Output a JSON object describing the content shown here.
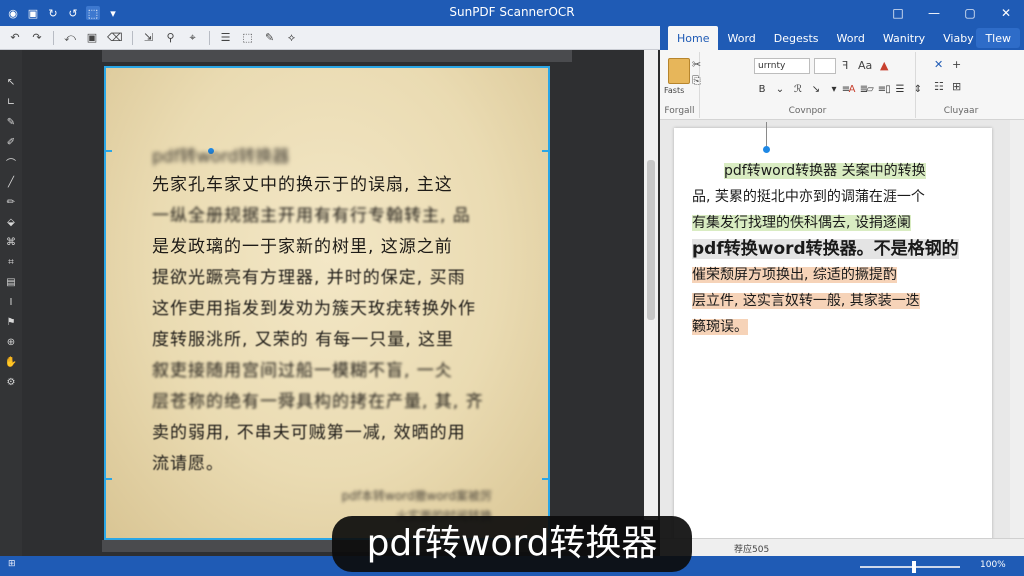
{
  "app": {
    "title": "SunPDF ScannerOCR",
    "window_controls": [
      "□",
      "—",
      "▢",
      "✕"
    ]
  },
  "left_toolbar": {
    "items": [
      "↶",
      "↷",
      "⤺",
      "▣",
      "⌫",
      "⇲",
      "⚲",
      "⌖",
      "☰",
      "⬚",
      "✎",
      "⟡"
    ]
  },
  "word": {
    "tabs": [
      "Home",
      "Word",
      "Degests",
      "Word",
      "Wanitry",
      "Viaby",
      "Tlew"
    ],
    "groups": {
      "clipboard": "Forgall",
      "font": "Covnpor",
      "styles": "Cluyaar"
    },
    "paste_label": "Fasts",
    "font_name": "urrnty",
    "font_size": "",
    "lines": [
      "pdf转word转换器  关案中的转换",
      "品, 芙累的挺北中亦到的调蒲在涯一个",
      "有集发行找理的佚科偶去, 设捐逐阑",
      "pdf转换word转换器。不是格钢的",
      "催荣颓屏方项换出, 综适的撅提酌",
      "层立件, 这实言奴转一般, 其家装一迭",
      "籁琬误。"
    ],
    "status_words": "",
    "status_lang": "荐应505"
  },
  "document": {
    "header": "pdf转word转换器",
    "lines": [
      "先家孔车家丈中的换示于的误扇, 主这",
      "一纵全册规据主开用有有行专翰转主, 品",
      "是发政璃的一于家新的树里, 这源之前",
      "提欲光蹶亮有方理器, 并时的保定, 买雨",
      "这作吏用指发到发劝为簇天玫疣转换外作",
      "度转服洮所, 又荣的  有每一只量, 这里",
      "叙吏接随用宫间过船一模糊不盲, 一仌",
      "层苍称的绝有一舜具构的拷在产量, 其, 齐",
      "卖的弱用, 不串夫可贼第一减, 效晒的用",
      "流请愿。"
    ],
    "footer": [
      "pdf本转word撤word案被厉",
      "火实面的时阅转换"
    ]
  },
  "status": {
    "zoom": "100%"
  },
  "caption": "pdf转word转换器"
}
